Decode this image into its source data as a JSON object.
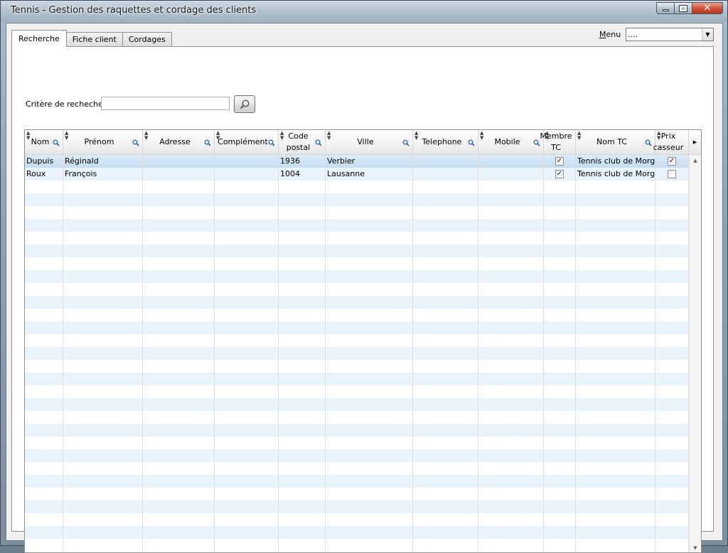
{
  "window": {
    "title": "Tennis - Gestion des raquettes et cordage des clients",
    "controls": {
      "minimize": "minimize",
      "maximize": "maximize",
      "close": "✕"
    }
  },
  "tabs": [
    {
      "label": "Recherche",
      "active": true
    },
    {
      "label": "Fiche client",
      "active": false
    },
    {
      "label": "Cordages",
      "active": false
    }
  ],
  "menu": {
    "label": "Menu",
    "selected": "...."
  },
  "search": {
    "label": "Critère de recheche",
    "value": "",
    "button_icon": "magnifier-icon"
  },
  "grid": {
    "columns": [
      {
        "key": "nom",
        "label": "Nom",
        "searchable": true
      },
      {
        "key": "prenom",
        "label": "Prénom",
        "searchable": true
      },
      {
        "key": "adresse",
        "label": "Adresse",
        "searchable": true
      },
      {
        "key": "complement",
        "label": "Complément",
        "searchable": true
      },
      {
        "key": "code_postal",
        "label": "Code\npostal",
        "searchable": true
      },
      {
        "key": "ville",
        "label": "Ville",
        "searchable": true
      },
      {
        "key": "telephone",
        "label": "Telephone",
        "searchable": true
      },
      {
        "key": "mobile",
        "label": "Mobile",
        "searchable": true
      },
      {
        "key": "membre_tc",
        "label": "Membre\nTC",
        "searchable": false,
        "checkbox": true
      },
      {
        "key": "nom_tc",
        "label": "Nom TC",
        "searchable": true
      },
      {
        "key": "prix_casseur",
        "label": "Prix\ncasseur",
        "searchable": false,
        "checkbox": true
      }
    ],
    "rows": [
      {
        "nom": "Dupuis",
        "prenom": "Réginald",
        "adresse": "",
        "complement": "",
        "code_postal": "1936",
        "ville": "Verbier",
        "telephone": "",
        "mobile": "",
        "membre_tc": true,
        "nom_tc": "Tennis club de Morges",
        "prix_casseur": true,
        "selected": true
      },
      {
        "nom": "Roux",
        "prenom": "François",
        "adresse": "",
        "complement": "",
        "code_postal": "1004",
        "ville": "Lausanne",
        "telephone": "",
        "mobile": "",
        "membre_tc": true,
        "nom_tc": "Tennis club de Morges",
        "prix_casseur": false,
        "selected": false
      }
    ],
    "empty_rows": 29
  },
  "colors": {
    "row_alt": "#eaf3fb",
    "row_selected": "#c4dcf1",
    "close_button": "#d0543a"
  }
}
